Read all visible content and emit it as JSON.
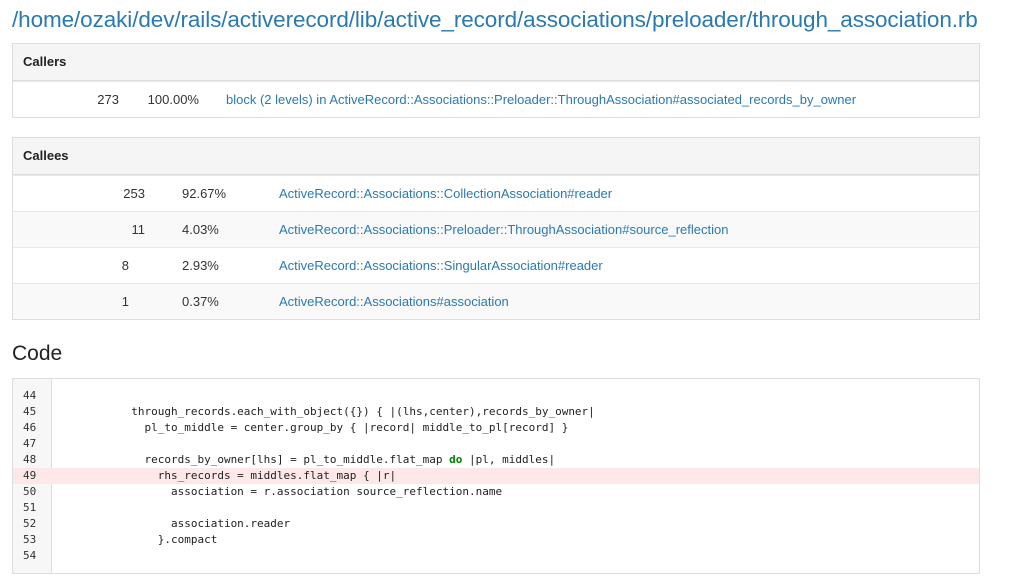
{
  "file_path": "/home/ozaki/dev/rails/activerecord/lib/active_record/associations/preloader/through_association.rb",
  "callers": {
    "title": "Callers",
    "rows": [
      {
        "calls": "273",
        "percent": "100.00%",
        "method": "block (2 levels) in ActiveRecord::Associations::Preloader::ThroughAssociation#associated_records_by_owner"
      }
    ]
  },
  "callees": {
    "title": "Callees",
    "rows": [
      {
        "calls": "253",
        "percent": "92.67%",
        "method": "ActiveRecord::Associations::CollectionAssociation#reader"
      },
      {
        "calls": "11",
        "percent": "4.03%",
        "method": "ActiveRecord::Associations::Preloader::ThroughAssociation#source_reflection"
      },
      {
        "calls": "8",
        "percent": "2.93%",
        "method": "ActiveRecord::Associations::SingularAssociation#reader"
      },
      {
        "calls": "1",
        "percent": "0.37%",
        "method": "ActiveRecord::Associations#association"
      }
    ]
  },
  "code": {
    "title": "Code",
    "highlight_color": "#fce8e8",
    "lines": [
      {
        "n": "44",
        "text": "",
        "hl": false
      },
      {
        "n": "45",
        "text": "          through_records.each_with_object({}) { |(lhs,center),records_by_owner|",
        "hl": false
      },
      {
        "n": "46",
        "text": "            pl_to_middle = center.group_by { |record| middle_to_pl[record] }",
        "hl": false
      },
      {
        "n": "47",
        "text": "",
        "hl": false
      },
      {
        "n": "48",
        "text": "            records_by_owner[lhs] = pl_to_middle.flat_map do |pl, middles|",
        "hl": false
      },
      {
        "n": "49",
        "text": "              rhs_records = middles.flat_map { |r|",
        "hl": true
      },
      {
        "n": "50",
        "text": "                association = r.association source_reflection.name",
        "hl": false
      },
      {
        "n": "51",
        "text": "",
        "hl": false
      },
      {
        "n": "52",
        "text": "                association.reader",
        "hl": false
      },
      {
        "n": "53",
        "text": "              }.compact",
        "hl": false
      },
      {
        "n": "54",
        "text": "",
        "hl": false
      }
    ]
  }
}
